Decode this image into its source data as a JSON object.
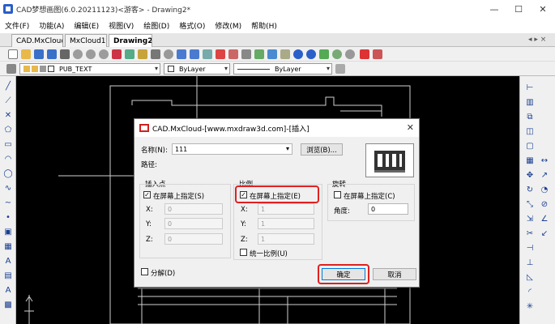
{
  "window": {
    "title": "CAD梦想画图(6.0.20211123)<游客> - Drawing2*",
    "min_glyph": "—",
    "max_glyph": "☐",
    "close_glyph": "✕"
  },
  "menu": [
    "文件(F)",
    "功能(A)",
    "编辑(E)",
    "视图(V)",
    "绘图(D)",
    "格式(O)",
    "修改(M)",
    "帮助(H)"
  ],
  "tabs": [
    {
      "label": "CAD.MxCloud",
      "active": false
    },
    {
      "label": "MxCloud1*",
      "active": false
    },
    {
      "label": "Drawing2*",
      "active": true
    }
  ],
  "tab_close_glyph": "×",
  "tab_scroll": "◂ ▸ ×",
  "toolbar2": {
    "layer": "PUB_TEXT",
    "color": "ByLayer",
    "linetype": "ByLayer",
    "dropdown_glyph": "▾"
  },
  "dialog": {
    "title": "CAD.MxCloud-[www.mxdraw3d.com]-[插入]",
    "close_glyph": "✕",
    "name_label": "名称(N):",
    "name_value": "111",
    "browse_label": "浏览(B)...",
    "path_label": "路径:",
    "check_glyph": "✓",
    "insert_point": {
      "title": "插入点",
      "onscreen_label": "在屏幕上指定(S)",
      "onscreen_checked": true,
      "x_label": "X:",
      "x_value": "0",
      "y_label": "Y:",
      "y_value": "0",
      "z_label": "Z:",
      "z_value": "0"
    },
    "scale": {
      "title": "比例",
      "onscreen_label": "在屏幕上指定(E)",
      "onscreen_checked": true,
      "x_label": "X:",
      "x_value": "1",
      "y_label": "Y:",
      "y_value": "1",
      "z_label": "Z:",
      "z_value": "1",
      "uniform_label": "统一比例(U)",
      "uniform_checked": false
    },
    "rotation": {
      "title": "旋转",
      "onscreen_label": "在屏幕上指定(C)",
      "onscreen_checked": false,
      "angle_label": "角度:",
      "angle_value": "0"
    },
    "explode_label": "分解(D)",
    "explode_checked": false,
    "ok_label": "确定",
    "cancel_label": "取消"
  },
  "colors": {
    "canvas": "#000000",
    "highlight": "#e02020",
    "accent": "#1a3f8f"
  }
}
